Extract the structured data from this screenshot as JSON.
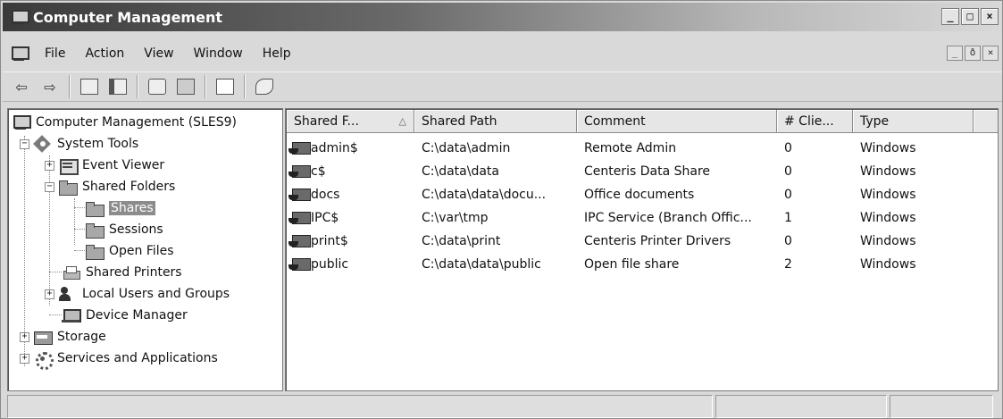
{
  "window": {
    "title": "Computer Management",
    "controls": [
      "_",
      "□",
      "×"
    ]
  },
  "menubar": {
    "items": [
      "File",
      "Action",
      "View",
      "Window",
      "Help"
    ],
    "mdi_controls": [
      "_",
      "ð",
      "×"
    ]
  },
  "toolbar": {
    "icons": [
      "back-arrow-icon",
      "forward-arrow-icon",
      "up-folder-icon",
      "show-hide-tree-icon",
      "refresh-icon",
      "export-list-icon",
      "help-icon",
      "connect-icon"
    ],
    "back_glyph": "⇦",
    "forward_glyph": "⇨"
  },
  "tree": {
    "root": "Computer Management (SLES9)",
    "system_tools": "System Tools",
    "event_viewer": "Event Viewer",
    "shared_folders": "Shared Folders",
    "shares": "Shares",
    "sessions": "Sessions",
    "open_files": "Open Files",
    "shared_printers": "Shared Printers",
    "local_users": "Local Users and Groups",
    "device_manager": "Device Manager",
    "storage": "Storage",
    "services": "Services and Applications",
    "selected": "Shares"
  },
  "list": {
    "columns": [
      "Shared F...",
      "Shared Path",
      "Comment",
      "# Clie...",
      "Type"
    ],
    "rows": [
      {
        "name": "admin$",
        "path": "C:\\data\\admin",
        "comment": "Remote Admin",
        "clients": "0",
        "type": "Windows"
      },
      {
        "name": "c$",
        "path": "C:\\data\\data",
        "comment": "Centeris Data Share",
        "clients": "0",
        "type": "Windows"
      },
      {
        "name": "docs",
        "path": "C:\\data\\data\\docu...",
        "comment": "Office documents",
        "clients": "0",
        "type": "Windows"
      },
      {
        "name": "IPC$",
        "path": "C:\\var\\tmp",
        "comment": "IPC Service (Branch Offic...",
        "clients": "1",
        "type": "Windows"
      },
      {
        "name": "print$",
        "path": "C:\\data\\print",
        "comment": "Centeris Printer Drivers",
        "clients": "0",
        "type": "Windows"
      },
      {
        "name": "public",
        "path": "C:\\data\\data\\public",
        "comment": "Open file share",
        "clients": "2",
        "type": "Windows"
      }
    ]
  },
  "colors": {
    "selection": "#8c8c8c",
    "window_bg": "#d9d9d9",
    "title_start": "#3a3a3a"
  }
}
